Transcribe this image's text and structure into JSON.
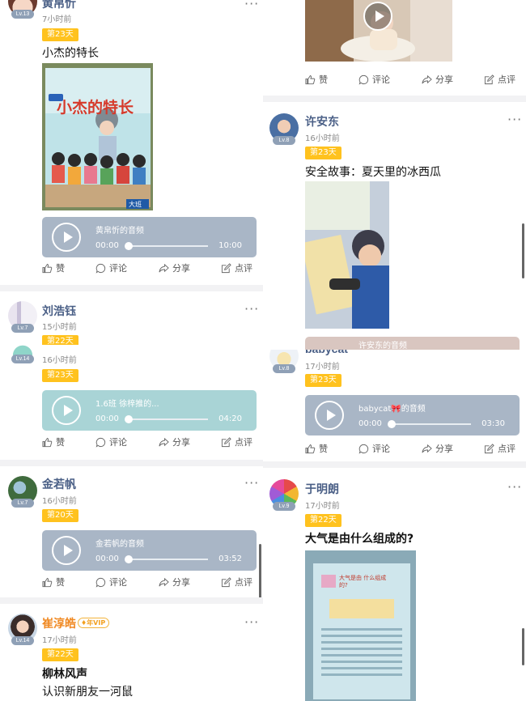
{
  "actions": {
    "like": "赞",
    "comment": "评论",
    "share": "分享",
    "review": "点评"
  },
  "left": [
    {
      "name": "黄帛忻",
      "level": "Lv.13",
      "time": "7小时前",
      "day": "第23天",
      "title": "小杰的特长",
      "book_title": "小杰的特长",
      "book_tag": "大班",
      "audio": {
        "title": "黄帛忻的音频",
        "start": "00:00",
        "end": "10:00"
      }
    },
    {
      "name": "刘浩钰",
      "level": "Lv.7",
      "time": "15小时前",
      "day": "第22天"
    },
    {
      "level": "Lv.14",
      "time": "16小时前",
      "day": "第23天",
      "audio": {
        "title": "1.6班 徐梓推的...",
        "start": "00:00",
        "end": "04:20"
      }
    },
    {
      "name": "金若帆",
      "level": "Lv.7",
      "time": "16小时前",
      "day": "第20天",
      "audio": {
        "title": "金若帆的音频",
        "start": "00:00",
        "end": "03:52"
      }
    },
    {
      "name": "崔淳皓",
      "vip": "年VIP",
      "level": "Lv.14",
      "time": "17小时前",
      "day": "第22天",
      "title": "柳林风声",
      "subtitle": "认识新朋友一河鼠"
    }
  ],
  "right": [
    {
      "name": "许安东",
      "level": "Lv.8",
      "time": "16小时前",
      "day": "第23天",
      "title": "安全故事：夏天里的冰西瓜",
      "audio_peek": "许安东的音频"
    },
    {
      "name": "babycat",
      "level": "Lv.8",
      "time": "17小时前",
      "day": "第23天",
      "audio": {
        "title": "babycat",
        "title_suffix": "的音频",
        "start": "00:00",
        "end": "03:30"
      }
    },
    {
      "name": "于明朗",
      "level": "Lv.9",
      "time": "17小时前",
      "day": "第22天",
      "title": "大气是由什么组成的?",
      "book_title": "大气是由 什么组成的?"
    }
  ],
  "colors": {
    "day_badge": "#ffc21e",
    "name": "#4a5f86",
    "vip_name": "#f08a24",
    "audio": "#a9b6c6",
    "audio_teal": "#a9d4d6"
  },
  "icons": [
    "play-icon",
    "thumb-up-icon",
    "comment-bubble-icon",
    "share-arrow-icon",
    "review-edit-icon",
    "more-dots-icon",
    "vip-badge-icon"
  ]
}
